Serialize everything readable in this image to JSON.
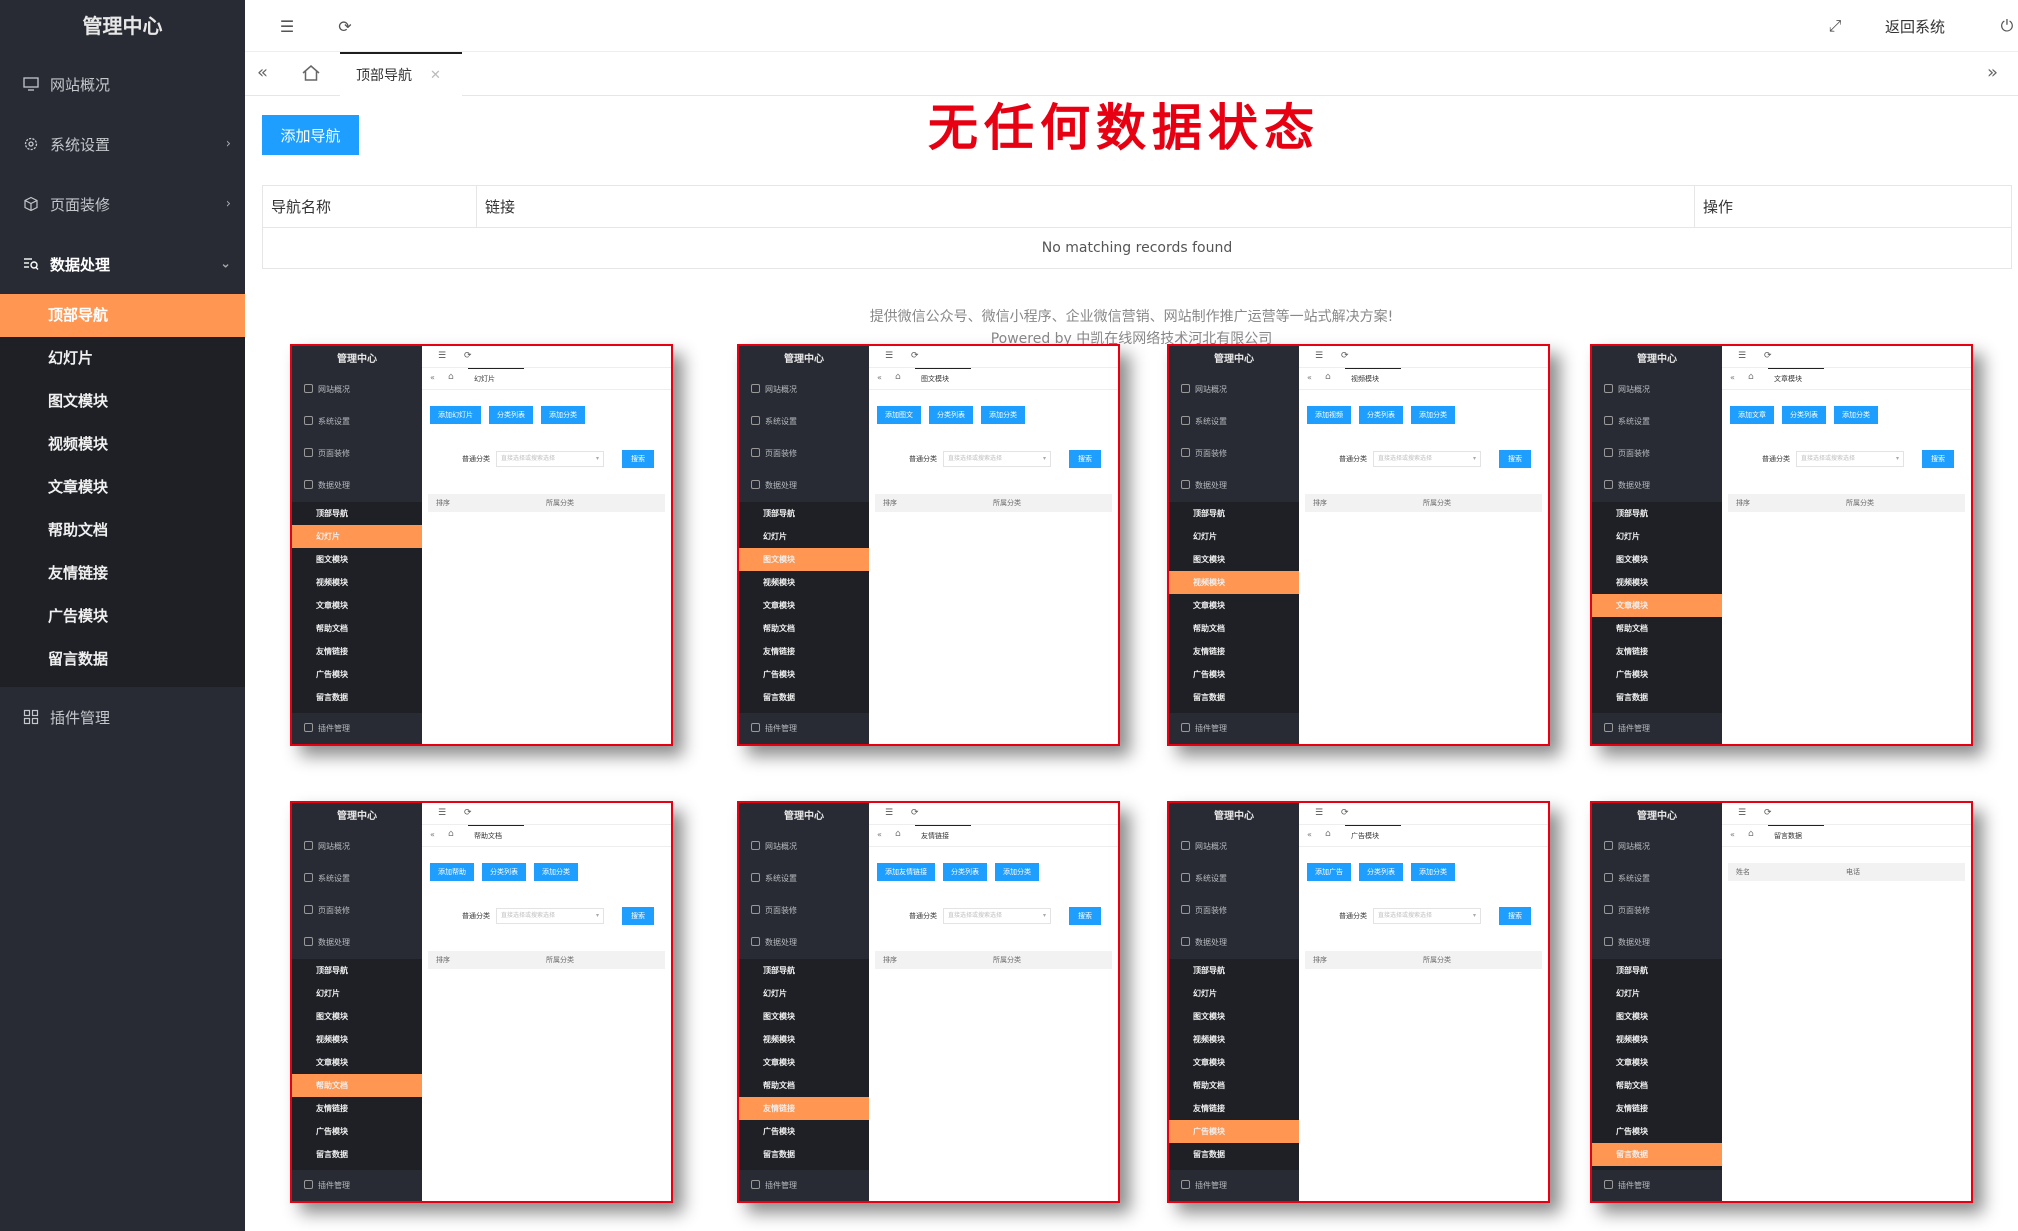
{
  "sidebar": {
    "title": "管理中心",
    "items": [
      {
        "label": "网站概况"
      },
      {
        "label": "系统设置"
      },
      {
        "label": "页面装修"
      },
      {
        "label": "数据处理"
      }
    ],
    "sub_items": [
      "顶部导航",
      "幻灯片",
      "图文模块",
      "视频模块",
      "文章模块",
      "帮助文档",
      "友情链接",
      "广告模块",
      "留言数据"
    ],
    "plugin": "插件管理"
  },
  "topbar": {
    "return_label": "返回系统"
  },
  "tabs": {
    "active_label": "顶部导航"
  },
  "headline": "无任何数据状态",
  "content": {
    "add_button": "添加导航",
    "columns": [
      "导航名称",
      "链接",
      "操作"
    ],
    "empty_text": "No matching records found"
  },
  "footer": {
    "line1": "提供微信公众号、微信小程序、企业微信营销、网站制作推广运营等一站式解决方案!",
    "line2": "Powered by 中凯在线网络技术河北有限公司"
  },
  "thumbs": [
    {
      "tab": "幻灯片",
      "active": 1,
      "buttons": [
        "添加幻灯片",
        "分类列表",
        "添加分类"
      ],
      "search_label": "普通分类",
      "placeholder": "直接选择或搜索选择",
      "search_btn": "搜索",
      "cols": [
        "排序",
        "所属分类"
      ]
    },
    {
      "tab": "图文模块",
      "active": 2,
      "buttons": [
        "添加图文",
        "分类列表",
        "添加分类"
      ],
      "search_label": "普通分类",
      "placeholder": "直接选择或搜索选择",
      "search_btn": "搜索",
      "cols": [
        "排序",
        "所属分类"
      ]
    },
    {
      "tab": "视频模块",
      "active": 3,
      "buttons": [
        "添加视频",
        "分类列表",
        "添加分类"
      ],
      "search_label": "普通分类",
      "placeholder": "直接选择或搜索选择",
      "search_btn": "搜索",
      "cols": [
        "排序",
        "所属分类"
      ]
    },
    {
      "tab": "文章模块",
      "active": 4,
      "buttons": [
        "添加文章",
        "分类列表",
        "添加分类"
      ],
      "search_label": "普通分类",
      "placeholder": "直接选择或搜索选择",
      "search_btn": "搜索",
      "cols": [
        "排序",
        "所属分类"
      ]
    },
    {
      "tab": "帮助文档",
      "active": 5,
      "buttons": [
        "添加帮助",
        "分类列表",
        "添加分类"
      ],
      "search_label": "普通分类",
      "placeholder": "直接选择或搜索选择",
      "search_btn": "搜索",
      "cols": [
        "排序",
        "所属分类"
      ]
    },
    {
      "tab": "友情链接",
      "active": 6,
      "buttons": [
        "添加友情链接",
        "分类列表",
        "添加分类"
      ],
      "search_label": "普通分类",
      "placeholder": "直接选择或搜索选择",
      "search_btn": "搜索",
      "cols": [
        "排序",
        "所属分类"
      ]
    },
    {
      "tab": "广告模块",
      "active": 7,
      "buttons": [
        "添加广告",
        "分类列表",
        "添加分类"
      ],
      "search_label": "普通分类",
      "placeholder": "直接选择或搜索选择",
      "search_btn": "搜索",
      "cols": [
        "排序",
        "所属分类"
      ]
    },
    {
      "tab": "留言数据",
      "active": 8,
      "buttons": [],
      "search_label": "",
      "placeholder": "",
      "search_btn": "",
      "cols": [
        "姓名",
        "电话"
      ]
    }
  ]
}
